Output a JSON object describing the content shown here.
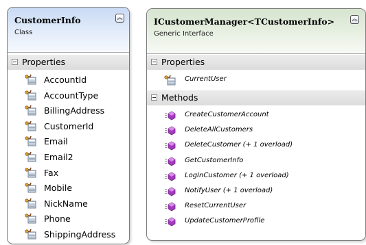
{
  "class_shape": {
    "name": "CustomerInfo",
    "kind": "Class",
    "collapse_glyph": "︽",
    "properties_title": "Properties",
    "properties": [
      "AccountId",
      "AccountType",
      "BillingAddress",
      "CustomerId",
      "Email",
      "Email2",
      "Fax",
      "Mobile",
      "NickName",
      "Phone",
      "ShippingAddress"
    ]
  },
  "interface_shape": {
    "name": "ICustomerManager<TCustomerInfo>",
    "kind": "Generic Interface",
    "collapse_glyph": "︽",
    "properties_title": "Properties",
    "properties": [
      "CurrentUser"
    ],
    "methods_title": "Methods",
    "methods": [
      "CreateCustomerAccount",
      "DeleteAllCustomers",
      "DeleteCustomer (+ 1 overload)",
      "GetCustomerInfo",
      "LogInCustomer (+ 1 overload)",
      "NotifyUser (+ 1 overload)",
      "ResetCurrentUser",
      "UpdateCustomerProfile"
    ]
  },
  "icons": {
    "property": "property-icon",
    "method": "method-icon",
    "section_toggle": "minus-box-icon",
    "collapse": "double-chevron-up-icon"
  },
  "colors": {
    "class_header": "#c9daf4",
    "interface_header": "#d6e4cf",
    "section_header": "#e4e4e4",
    "border": "#7c7c7c",
    "method_icon": "#a43bbf"
  }
}
